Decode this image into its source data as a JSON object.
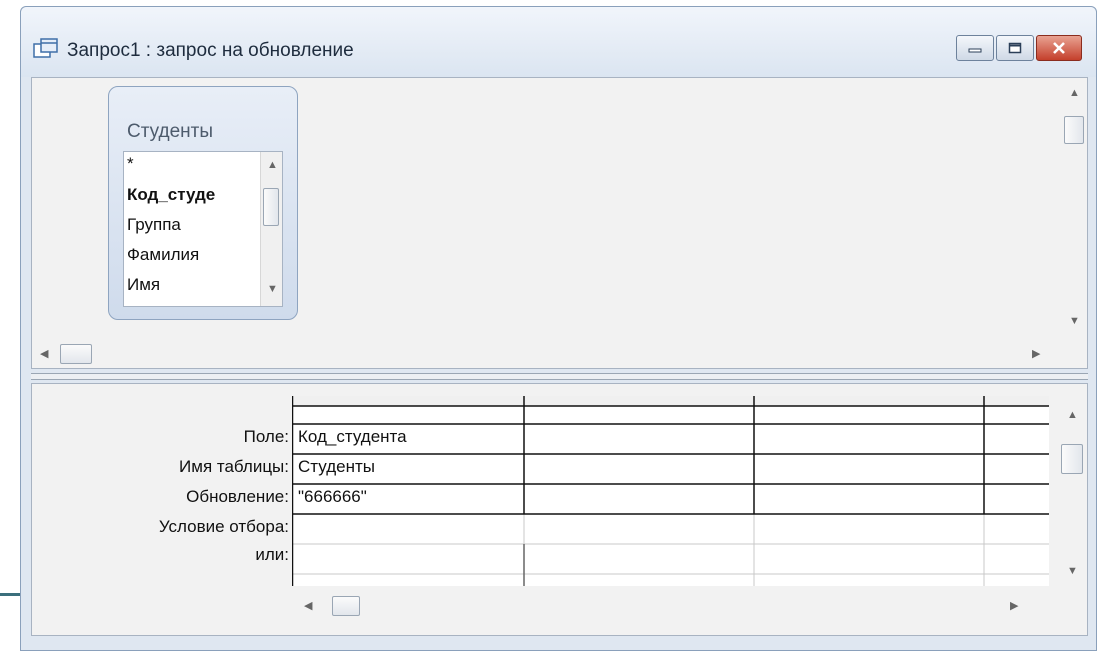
{
  "window": {
    "title": "Запрос1 : запрос на обновление",
    "controls": [
      "minimize-icon",
      "maximize-icon",
      "close-icon"
    ],
    "close_color": "#c4402c"
  },
  "table_card": {
    "title": "Студенты",
    "fields": [
      {
        "label": "*",
        "bold": false
      },
      {
        "label": "Код_студе",
        "bold": true
      },
      {
        "label": "Группа",
        "bold": false
      },
      {
        "label": "Фамилия",
        "bold": false
      },
      {
        "label": "Имя",
        "bold": false
      }
    ]
  },
  "grid": {
    "row_labels": [
      "Поле:",
      "Имя таблицы:",
      "Обновление:",
      "Условие отбора:",
      "или:"
    ],
    "columns": [
      {
        "field": "Код_студента",
        "table": "Студенты",
        "update": "\"666666\"",
        "criteria": "",
        "or": ""
      },
      {
        "field": "",
        "table": "",
        "update": "",
        "criteria": "",
        "or": ""
      },
      {
        "field": "",
        "table": "",
        "update": "",
        "criteria": "",
        "or": ""
      },
      {
        "field": "",
        "table": "",
        "update": "",
        "criteria": "",
        "or": ""
      }
    ]
  }
}
